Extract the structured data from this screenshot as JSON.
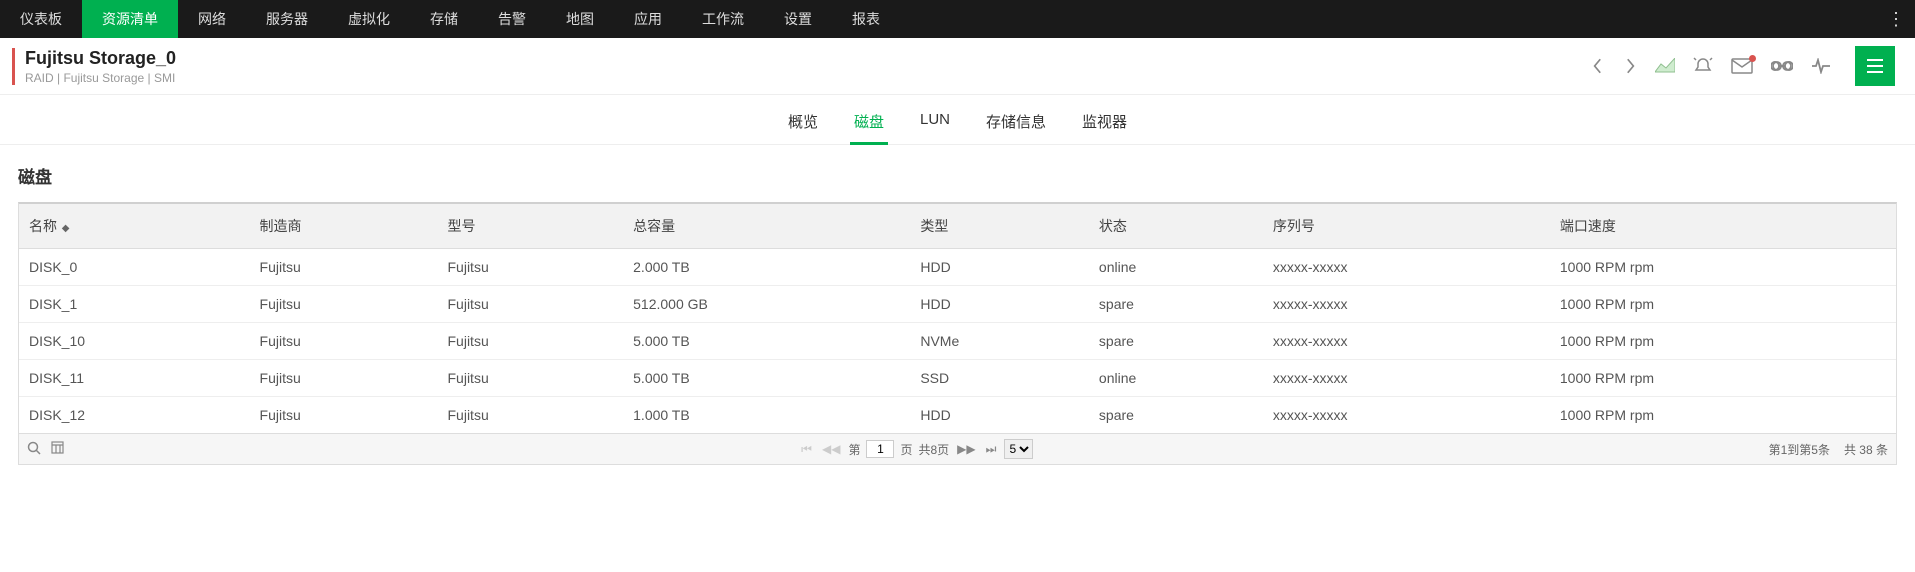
{
  "topnav": {
    "items": [
      "仪表板",
      "资源清单",
      "网络",
      "服务器",
      "虚拟化",
      "存储",
      "告警",
      "地图",
      "应用",
      "工作流",
      "设置",
      "报表"
    ],
    "active_index": 1
  },
  "header": {
    "title": "Fujitsu Storage_0",
    "breadcrumb": "RAID  | Fujitsu Storage  | SMI"
  },
  "subtabs": {
    "items": [
      "概览",
      "磁盘",
      "LUN",
      "存储信息",
      "监视器"
    ],
    "active_index": 1
  },
  "section": {
    "title": "磁盘"
  },
  "table": {
    "columns": [
      "名称",
      "制造商",
      "型号",
      "总容量",
      "类型",
      "状态",
      "序列号",
      "端口速度"
    ],
    "sort_col": 0,
    "rows": [
      {
        "name": "DISK_0",
        "mfr": "Fujitsu",
        "model": "Fujitsu",
        "cap": "2.000 TB",
        "type": "HDD",
        "status": "online",
        "serial": "xxxxx-xxxxx",
        "port": "1000 RPM rpm"
      },
      {
        "name": "DISK_1",
        "mfr": "Fujitsu",
        "model": "Fujitsu",
        "cap": "512.000 GB",
        "type": "HDD",
        "status": "spare",
        "serial": "xxxxx-xxxxx",
        "port": "1000 RPM rpm"
      },
      {
        "name": "DISK_10",
        "mfr": "Fujitsu",
        "model": "Fujitsu",
        "cap": "5.000 TB",
        "type": "NVMe",
        "status": "spare",
        "serial": "xxxxx-xxxxx",
        "port": "1000 RPM rpm"
      },
      {
        "name": "DISK_11",
        "mfr": "Fujitsu",
        "model": "Fujitsu",
        "cap": "5.000 TB",
        "type": "SSD",
        "status": "online",
        "serial": "xxxxx-xxxxx",
        "port": "1000 RPM rpm"
      },
      {
        "name": "DISK_12",
        "mfr": "Fujitsu",
        "model": "Fujitsu",
        "cap": "1.000 TB",
        "type": "HDD",
        "status": "spare",
        "serial": "xxxxx-xxxxx",
        "port": "1000 RPM rpm"
      }
    ]
  },
  "pager": {
    "page_prefix": "第",
    "page_value": "1",
    "page_suffix": "页",
    "total_pages": "共8页",
    "page_size": "5",
    "range": "第1到第5条",
    "total": "共 38 条"
  }
}
